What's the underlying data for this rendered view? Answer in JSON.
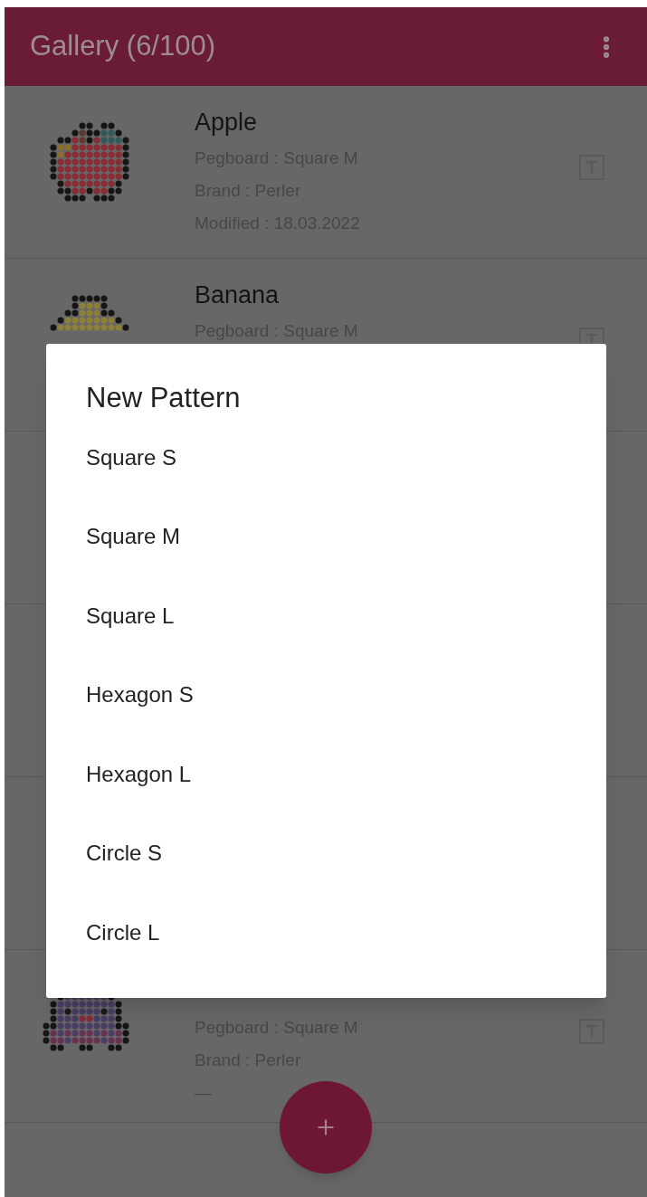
{
  "app_bar": {
    "title": "Gallery (6/100)"
  },
  "patterns_above_dialog": [
    {
      "title": "Apple",
      "details": [
        "Pegboard : Square M",
        "Brand : Perler",
        "Modified : 18.03.2022"
      ]
    },
    {
      "title": "Banana",
      "details": [
        "Pegboard : Square M"
      ]
    }
  ],
  "patterns_below_dialog": [
    {
      "details": [
        "Pegboard : Square M",
        "Brand : Perler",
        "—"
      ]
    }
  ],
  "dialog": {
    "title": "New Pattern",
    "options": [
      "Square S",
      "Square M",
      "Square L",
      "Hexagon S",
      "Hexagon L",
      "Circle S",
      "Circle L"
    ]
  }
}
